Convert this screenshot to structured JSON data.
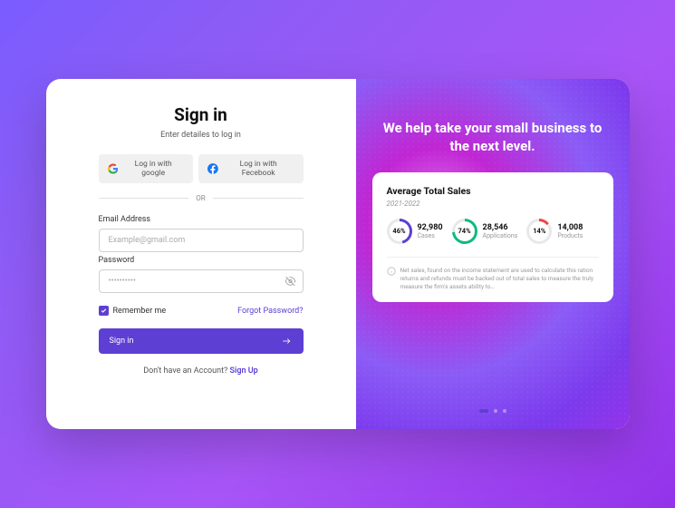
{
  "left": {
    "title": "Sign in",
    "subtitle": "Enter detailes to log in",
    "google_label": "Log in with google",
    "facebook_label": "Log in with Fecebook",
    "divider": "OR",
    "email_label": "Email Address",
    "email_placeholder": "Example@gmail.com",
    "password_label": "Password",
    "password_placeholder": "••••••••••",
    "remember_label": "Remember me",
    "forgot_label": "Forgot Password?",
    "signin_label": "Sign in",
    "signup_prompt": "Don't have an Account? ",
    "signup_link": "Sign Up"
  },
  "right": {
    "hero": "We help take your small business to the next level.",
    "card": {
      "title": "Average Total Sales",
      "period": "2021-2022",
      "stats": [
        {
          "pct": "46%",
          "value": "92,980",
          "label": "Cases",
          "color": "#5d3fd3",
          "p": 46
        },
        {
          "pct": "74%",
          "value": "28,546",
          "label": "Applications",
          "color": "#10b981",
          "p": 74
        },
        {
          "pct": "14%",
          "value": "14,008",
          "label": "Products",
          "color": "#ef4444",
          "p": 14
        }
      ],
      "note": "Net sales, found on the income statement are used to calculate this ration returns and refunds must be backed out of total sales to measure the truly measure the firm's assets ability to…"
    }
  }
}
